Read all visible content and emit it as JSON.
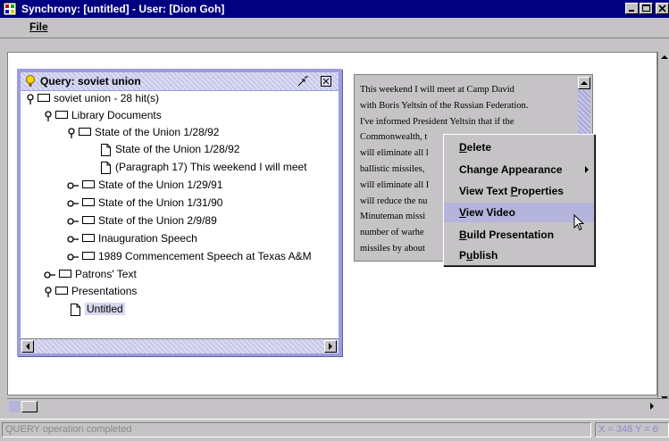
{
  "window": {
    "title": "Synchrony: [untitled] - User: [Dion Goh]"
  },
  "menu": {
    "file": "File"
  },
  "query_panel": {
    "title": "Query: soviet union",
    "tree": [
      {
        "label": "soviet union - 28 hit(s)",
        "kind": "folder",
        "toggle": "pin"
      },
      {
        "label": "Library Documents",
        "kind": "folder",
        "toggle": "pin"
      },
      {
        "label": "State of the Union 1/28/92",
        "kind": "folder",
        "toggle": "pin"
      },
      {
        "label": "State of the Union 1/28/92",
        "kind": "doc"
      },
      {
        "label": "(Paragraph 17) This weekend I will meet",
        "kind": "doc"
      },
      {
        "label": "State of the Union 1/29/91",
        "kind": "folder",
        "toggle": "key"
      },
      {
        "label": "State of the Union 1/31/90",
        "kind": "folder",
        "toggle": "key"
      },
      {
        "label": "State of the Union 2/9/89",
        "kind": "folder",
        "toggle": "key"
      },
      {
        "label": "Inauguration Speech",
        "kind": "folder",
        "toggle": "key"
      },
      {
        "label": "1989 Commencement Speech at Texas A&M",
        "kind": "folder",
        "toggle": "key"
      },
      {
        "label": "Patrons' Text",
        "kind": "folder",
        "toggle": "key"
      },
      {
        "label": "Presentations",
        "kind": "folder",
        "toggle": "pin"
      },
      {
        "label": "Untitled",
        "kind": "doc",
        "selected": true
      }
    ]
  },
  "text_panel": {
    "lines": [
      "This weekend I will meet at Camp David",
      "with Boris Yeltsin of the Russian Federation.",
      "I've informed President Yeltsin that if the",
      "Commonwealth, t",
      "will eliminate all l",
      "ballistic missiles,",
      "will eliminate all I",
      "will reduce the nu",
      "Minuteman missi",
      "number of warhe",
      "missiles by about"
    ]
  },
  "context_menu": {
    "items": [
      {
        "pre": "",
        "ul": "D",
        "post": "elete"
      },
      {
        "pre": "",
        "ul": "",
        "post": "Change Appearance",
        "submenu": true
      },
      {
        "pre": "View Text ",
        "ul": "P",
        "post": "roperties"
      },
      {
        "pre": "",
        "ul": "V",
        "post": "iew Video",
        "selected": true
      },
      {
        "pre": "",
        "ul": "B",
        "post": "uild Presentation"
      },
      {
        "pre": "P",
        "ul": "u",
        "post": "blish"
      }
    ]
  },
  "status": {
    "message": "QUERY operation completed",
    "coords": "X = 348  Y = 6"
  },
  "colors": {
    "titlebar": "#000080",
    "panel_border": "#9c9ce0",
    "selection": "#b4b4dc"
  }
}
